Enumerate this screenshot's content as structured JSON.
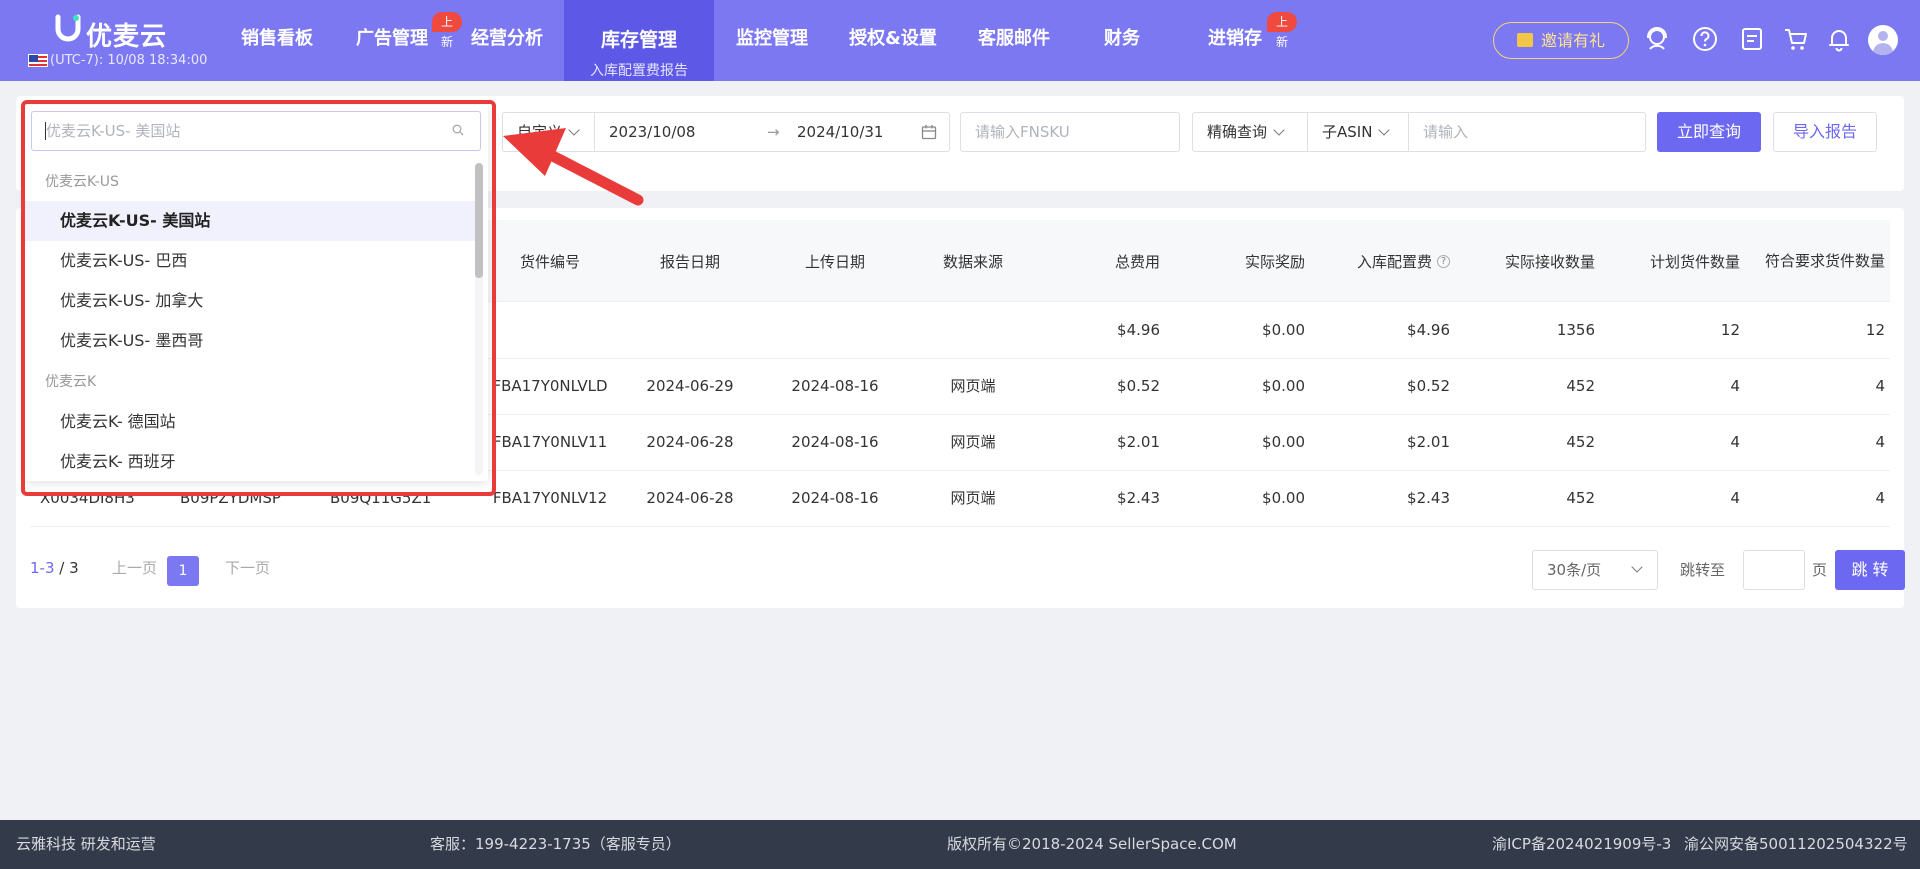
{
  "brand": {
    "name": "优麦云",
    "timezone": "(UTC-7): 10/08 18:34:00"
  },
  "nav": {
    "items": [
      {
        "label": "销售看板"
      },
      {
        "label": "广告管理",
        "badge": "上新"
      },
      {
        "label": "经营分析"
      },
      {
        "label": "库存管理",
        "sub": "入库配置费报告"
      },
      {
        "label": "监控管理"
      },
      {
        "label": "授权&设置"
      },
      {
        "label": "客服邮件"
      },
      {
        "label": "财务"
      },
      {
        "label": "进销存",
        "badge": "上新"
      }
    ],
    "invite": "邀请有礼"
  },
  "filters": {
    "date_mode": "自定义",
    "date_start": "2023/10/08",
    "date_end": "2024/10/31",
    "fnsku_placeholder": "请输入FNSKU",
    "match_mode": "精确查询",
    "asin_type": "子ASIN",
    "keyword_placeholder": "请输入",
    "query_button": "立即查询",
    "import_button": "导入报告"
  },
  "dropdown": {
    "placeholder": "优麦云K-US- 美国站",
    "groups": [
      {
        "label": "优麦云K-US",
        "options": [
          "优麦云K-US- 美国站",
          "优麦云K-US- 巴西",
          "优麦云K-US- 加拿大",
          "优麦云K-US- 墨西哥"
        ]
      },
      {
        "label": "优麦云K",
        "options": [
          "优麦云K- 德国站",
          "优麦云K- 西班牙"
        ]
      }
    ]
  },
  "table": {
    "headers": [
      "货件编号",
      "报告日期",
      "上传日期",
      "数据来源",
      "总费用",
      "实际奖励",
      "入库配置费",
      "实际接收数量",
      "计划货件数量",
      "符合要求货件数量"
    ],
    "summary": {
      "total_fee": "$4.96",
      "reward": "$0.00",
      "config_fee": "$4.96",
      "received": "1356",
      "planned": "12",
      "qualified": "12"
    },
    "rows": [
      {
        "fnsku": "",
        "asin": "",
        "msku": "",
        "shipment": "FBA17Y0NLVLD",
        "report_date": "2024-06-29",
        "upload_date": "2024-08-16",
        "source": "网页端",
        "total_fee": "$0.52",
        "reward": "$0.00",
        "config_fee": "$0.52",
        "received": "452",
        "planned": "4",
        "qualified": "4"
      },
      {
        "fnsku": "",
        "asin": "",
        "msku": "",
        "shipment": "FBA17Y0NLV11",
        "report_date": "2024-06-28",
        "upload_date": "2024-08-16",
        "source": "网页端",
        "total_fee": "$2.01",
        "reward": "$0.00",
        "config_fee": "$2.01",
        "received": "452",
        "planned": "4",
        "qualified": "4"
      },
      {
        "fnsku": "X0034DI8H3",
        "asin": "B09PZYDMSP",
        "msku": "B09Q11G5Z1",
        "shipment": "FBA17Y0NLV12",
        "report_date": "2024-06-28",
        "upload_date": "2024-08-16",
        "source": "网页端",
        "total_fee": "$2.43",
        "reward": "$0.00",
        "config_fee": "$2.43",
        "received": "452",
        "planned": "4",
        "qualified": "4"
      }
    ]
  },
  "pagination": {
    "range": "1-3",
    "total": "/ 3",
    "prev": "上一页",
    "next": "下一页",
    "current": "1",
    "page_size": "30条/页",
    "jump_to": "跳转至",
    "page_unit": "页",
    "jump_button": "跳 转"
  },
  "footer": {
    "company": "云雅科技 研发和运营",
    "service": "客服：199-4223-1735（客服专员）",
    "copyright": "版权所有©2018-2024 SellerSpace.COM",
    "icp": "渝ICP备2024021909号-3",
    "police": "渝公网安备50011202504322号"
  },
  "colors": {
    "primary": "#6d68f1",
    "nav_bg": "#7b78f2",
    "nav_active": "#5d58e6",
    "highlight": "#ea3b3b",
    "badge": "#f04a3e"
  }
}
